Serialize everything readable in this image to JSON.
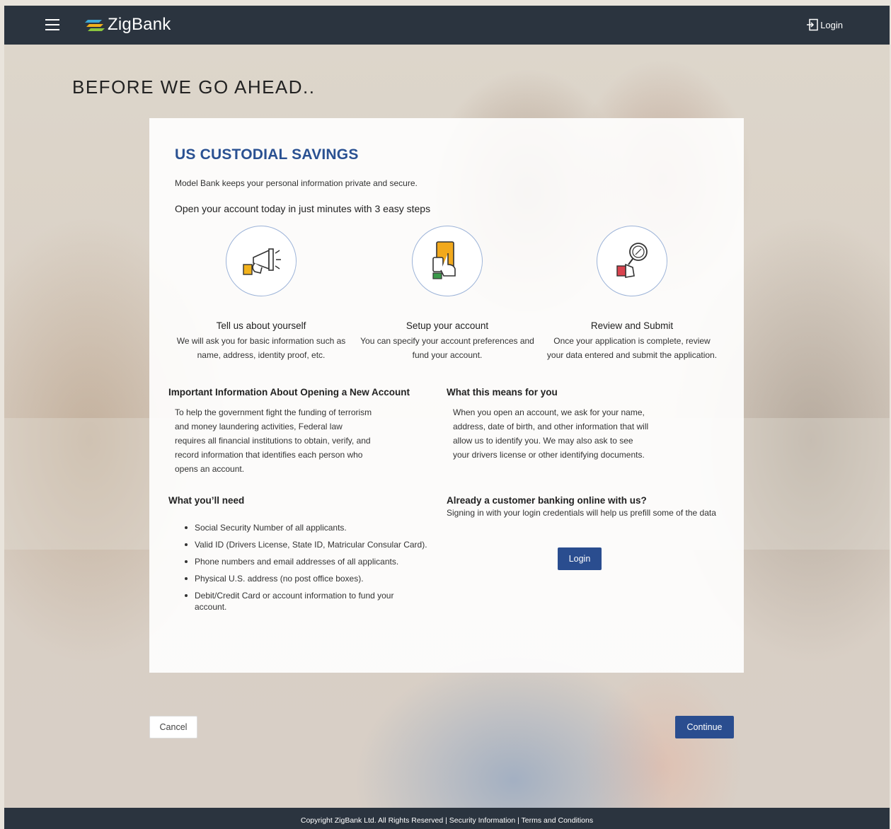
{
  "header": {
    "brand": "ZigBank",
    "login_label": "Login"
  },
  "page": {
    "title": "BEFORE WE GO AHEAD.."
  },
  "card": {
    "title": "US CUSTODIAL SAVINGS",
    "subtitle": "Model Bank keeps your personal information private and secure.",
    "steps_heading": "Open your account today in just minutes with 3 easy steps",
    "steps": [
      {
        "icon": "megaphone-icon",
        "label": "Tell us about yourself",
        "desc": "We will ask you for basic information such as name, address, identity proof, etc."
      },
      {
        "icon": "tablet-hand-icon",
        "label": "Setup your account",
        "desc": "You can specify your account preferences and fund your account."
      },
      {
        "icon": "magnifier-hand-icon",
        "label": "Review and Submit",
        "desc": "Once your application is complete, review your data entered and submit the application."
      }
    ],
    "important": {
      "heading": "Important Information About Opening a New Account",
      "text": "To help the government fight the funding of terrorism and money laundering activities, Federal law requires all financial institutions to obtain, verify, and record information that identifies each person who opens an account."
    },
    "means": {
      "heading": "What this means for you",
      "text": "When you open an account, we ask for your name, address, date of birth, and other information that will allow us to identify you. We may also ask to see your drivers license or other identifying documents."
    },
    "needs": {
      "heading": "What you’ll need",
      "items": [
        "Social Security Number of all applicants.",
        "Valid ID (Drivers License, State ID, Matricular Consular Card).",
        "Phone numbers and email addresses of all applicants.",
        "Physical U.S. address (no post office boxes).",
        "Debit/Credit Card or account information to fund your account."
      ]
    },
    "existing": {
      "heading": "Already a customer banking online with us?",
      "text": "Signing in with your login credentials will help us prefill some of the data",
      "login_button": "Login"
    }
  },
  "actions": {
    "cancel": "Cancel",
    "continue": "Continue"
  },
  "footer": {
    "copyright": "Copyright ZigBank Ltd. All Rights Reserved",
    "separator": " | ",
    "security": "Security Information",
    "terms": "Terms and Conditions"
  },
  "colors": {
    "header_bg": "#2b343f",
    "brand_blue": "#2a5192",
    "button_blue": "#2a4d8f"
  }
}
